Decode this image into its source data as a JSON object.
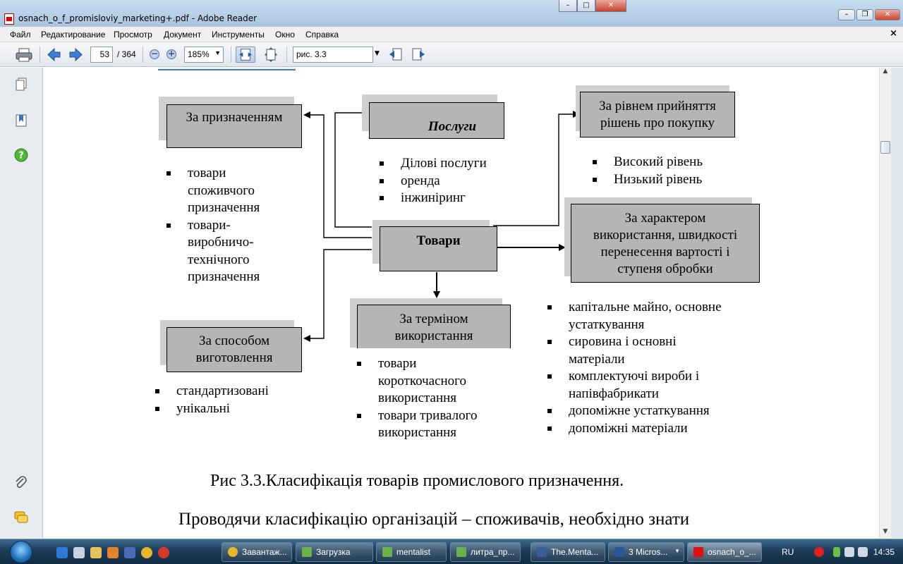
{
  "window": {
    "title": "osnach_o_f_promisloviy_marketing+.pdf - Adobe Reader"
  },
  "menu": {
    "items": [
      "Файл",
      "Редактирование",
      "Просмотр",
      "Документ",
      "Инструменты",
      "Окно",
      "Справка"
    ]
  },
  "toolbar": {
    "current_page": "53",
    "page_total": "/ 364",
    "zoom": "185%",
    "search_value": "рис. 3.3"
  },
  "diagram": {
    "center": "Товари",
    "boxes": {
      "purpose": "За призначенням",
      "services": "Послуги",
      "decision": [
        "За рівнем прийняття",
        "рішень про покупку"
      ],
      "usage_character": [
        "За характером",
        "використання, швидкості",
        "перенесення вартості і",
        "ступеня обробки"
      ],
      "manufacturing": [
        "За способом",
        "виготовлення"
      ],
      "term": [
        "За  терміном",
        "використання"
      ]
    },
    "lists": {
      "purpose": [
        "товари",
        "споживчого",
        "призначення",
        "товари-",
        "виробничо-",
        "технічного",
        "призначення"
      ],
      "services": [
        "Ділові послуги",
        "оренда",
        "інжиніринг"
      ],
      "decision": [
        "Високий рівень",
        "Низький рівень"
      ],
      "manufacturing": [
        "стандартизовані",
        "унікальні"
      ],
      "term": [
        "товари",
        "короткочасного",
        "використання",
        "товари тривалого",
        "використання"
      ],
      "usage_character": [
        "капітальне майно, основне",
        "устаткування",
        "сировина і основні",
        "матеріали",
        "комплектуючі вироби і",
        "напівфабрикати",
        "допоміжне устаткування",
        "допоміжні матеріали"
      ]
    },
    "caption": "Рис 3.3.Класифікація товарів промислового призначення.",
    "body_text": "Проводячи класифікацію організацій – споживачів, необхідно знати"
  },
  "taskbar": {
    "tasks": [
      "Завантаж...",
      "Загрузка",
      "mentalist",
      "литра_пр...",
      "The.Menta...",
      "3 Micros...",
      "osnach_o_..."
    ],
    "language": "RU",
    "clock": "14:35"
  }
}
